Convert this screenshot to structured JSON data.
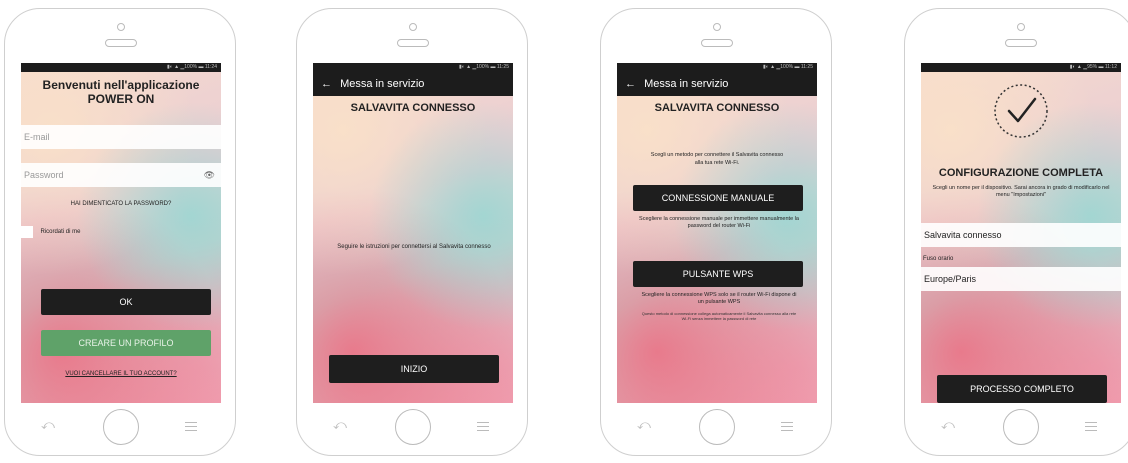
{
  "screen1": {
    "status": "▮◐ ▲ ▁100% ▬ 11:24",
    "title": "Benvenuti nell'applicazione POWER ON",
    "email_placeholder": "E-mail",
    "password_placeholder": "Password",
    "forgot": "HAI DIMENTICATO LA PASSWORD?",
    "remember": "Ricordati di me",
    "ok": "OK",
    "create": "CREARE UN PROFILO",
    "delete_account": "VUOI CANCELLARE IL TUO ACCOUNT?"
  },
  "screen2": {
    "status": "▮◐ ▲ ▁100% ▬ 11:25",
    "appbar_title": "Messa in servizio",
    "title": "SALVAVITA CONNESSO",
    "instructions": "Seguire le istruzioni per connettersi al Salvavita connesso",
    "start": "INIZIO"
  },
  "screen3": {
    "status": "▮◐ ▲ ▁100% ▬ 11:25",
    "appbar_title": "Messa in servizio",
    "title": "SALVAVITA CONNESSO",
    "choose": "Scegli un metodo per connettere il Salvavita connesso alla tua rete Wi-Fi.",
    "manual": "CONNESSIONE MANUALE",
    "manual_desc": "Scegliere la connessione manuale per immettere manualmente la password del router Wi-Fi",
    "wps": "PULSANTE WPS",
    "wps_desc": "Scegliere la connessione WPS solo se il router Wi-Fi dispone di un pulsante WPS",
    "wps_note": "Questo metodo di connessione collega automaticamente il Salvavita connesso alla rete Wi-Fi senza immettere la password di rete"
  },
  "screen4": {
    "status": "▮◐ ▲ ▁95% ▬ 11:12",
    "title": "CONFIGURAZIONE COMPLETA",
    "subtitle": "Scegli un nome per il dispositivo. Sarai ancora in grado di modificarlo nel menu \"Impostazioni\"",
    "name_value": "Salvavita connesso",
    "timezone_label": "Fuso orario",
    "timezone_value": "Europe/Paris",
    "finish": "PROCESSO COMPLETO"
  }
}
